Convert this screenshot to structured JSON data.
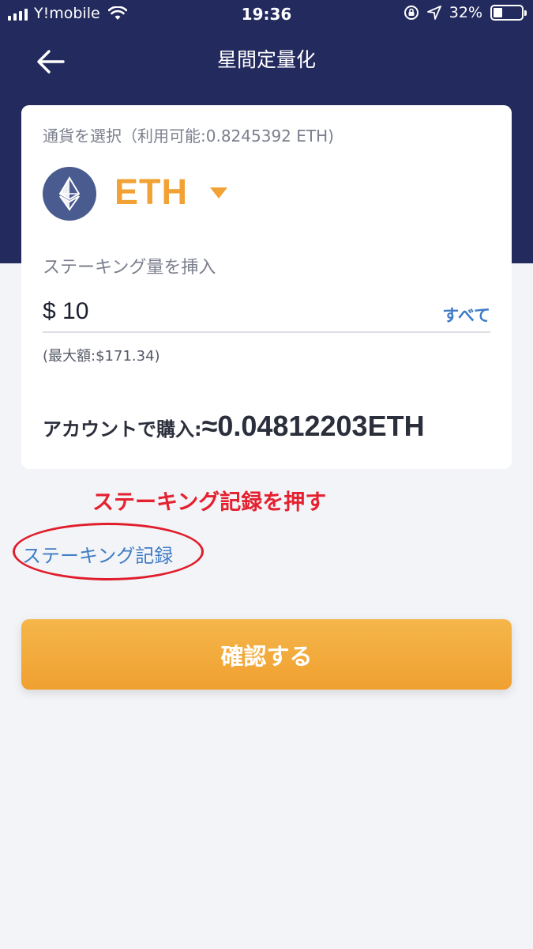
{
  "status_bar": {
    "carrier": "Y!mobile",
    "time": "19:36",
    "battery_percent": "32%",
    "battery_level": 0.32
  },
  "header": {
    "title": "星間定量化",
    "back_icon": "arrow-left-icon"
  },
  "card": {
    "currency_label": "通貨を選択（利用可能:0.8245392 ETH)",
    "currency_symbol": "ETH",
    "currency_icon": "ethereum-icon",
    "stake_label": "ステーキング量を挿入",
    "amount_value": "$ 10",
    "all_button": "すべて",
    "max_label": "(最大額:$171.34)",
    "buy_label": "アカウントで購入:",
    "buy_value": "≈0.04812203ETH"
  },
  "annotation": {
    "text": "ステーキング記録を押す"
  },
  "records_link": "ステーキング記録",
  "confirm_button": "確認する",
  "colors": {
    "header_bg": "#232a5e",
    "accent": "#f2a235",
    "link": "#3f7cc6",
    "annotation": "#e5202f"
  }
}
